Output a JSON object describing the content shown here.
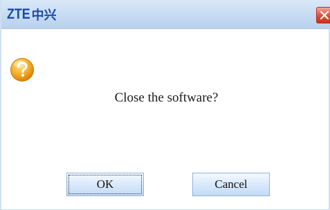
{
  "window": {
    "brand_latin": "ZTE",
    "brand_chinese": "中兴",
    "close_icon": "close-icon",
    "close_color": "#e24a37",
    "titlebar_color": "#c6dbf2"
  },
  "dialog": {
    "icon": "question-icon",
    "icon_color": "#f0a020",
    "message": "Close the software?"
  },
  "buttons": {
    "ok_label": "OK",
    "cancel_label": "Cancel"
  }
}
